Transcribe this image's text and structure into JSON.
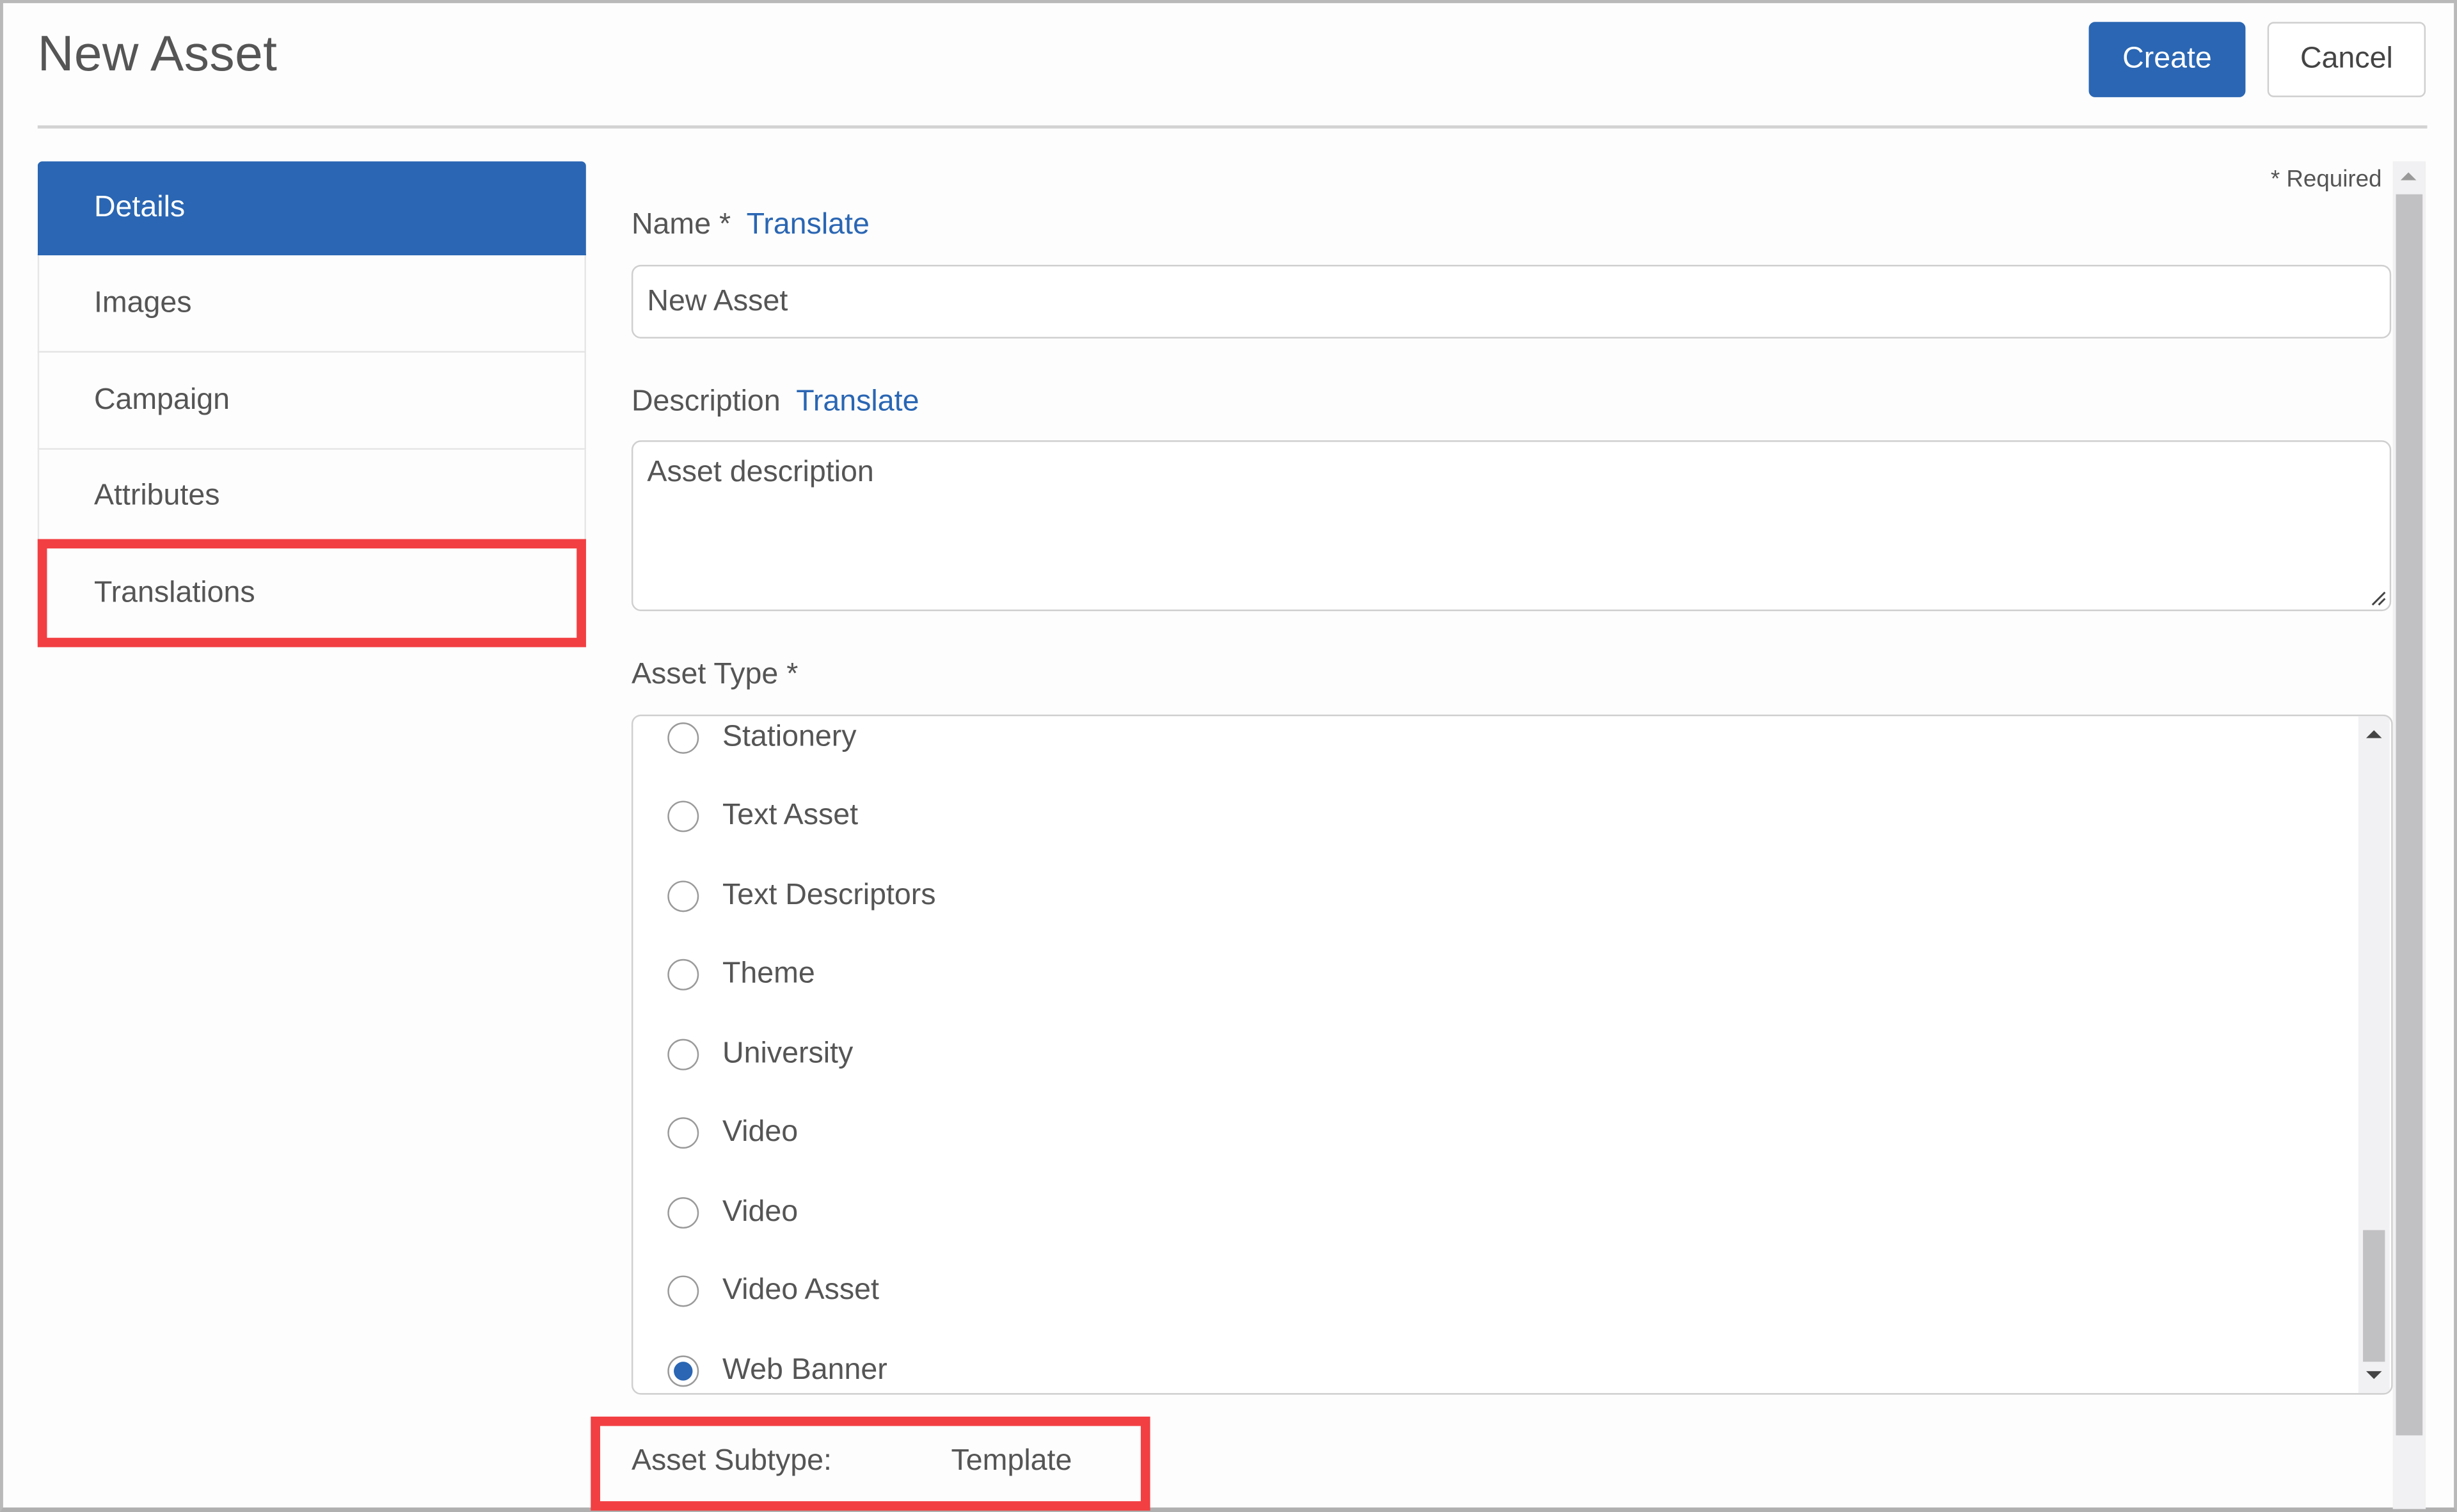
{
  "header": {
    "title": "New Asset",
    "create_label": "Create",
    "cancel_label": "Cancel"
  },
  "colors": {
    "accent": "#2a66b3",
    "highlight": "#f23f42"
  },
  "sidebar": {
    "items": [
      {
        "label": "Details",
        "active": true
      },
      {
        "label": "Images",
        "active": false
      },
      {
        "label": "Campaign",
        "active": false
      },
      {
        "label": "Attributes",
        "active": false
      },
      {
        "label": "Translations",
        "active": false,
        "highlighted": true
      }
    ]
  },
  "form": {
    "required_note": "* Required",
    "name": {
      "label": "Name *",
      "translate_link": "Translate",
      "value": "New Asset"
    },
    "description": {
      "label": "Description",
      "translate_link": "Translate",
      "value": "Asset description"
    },
    "asset_type": {
      "label": "Asset Type *",
      "options": [
        {
          "label": "Stationery",
          "checked": false
        },
        {
          "label": "Text Asset",
          "checked": false
        },
        {
          "label": "Text Descriptors",
          "checked": false
        },
        {
          "label": "Theme",
          "checked": false
        },
        {
          "label": "University",
          "checked": false
        },
        {
          "label": "Video",
          "checked": false
        },
        {
          "label": "Video",
          "checked": false
        },
        {
          "label": "Video Asset",
          "checked": false
        },
        {
          "label": "Web Banner",
          "checked": true
        }
      ],
      "selected": "Web Banner"
    },
    "asset_subtype": {
      "label": "Asset Subtype:",
      "value": "Template",
      "highlighted": true
    }
  }
}
